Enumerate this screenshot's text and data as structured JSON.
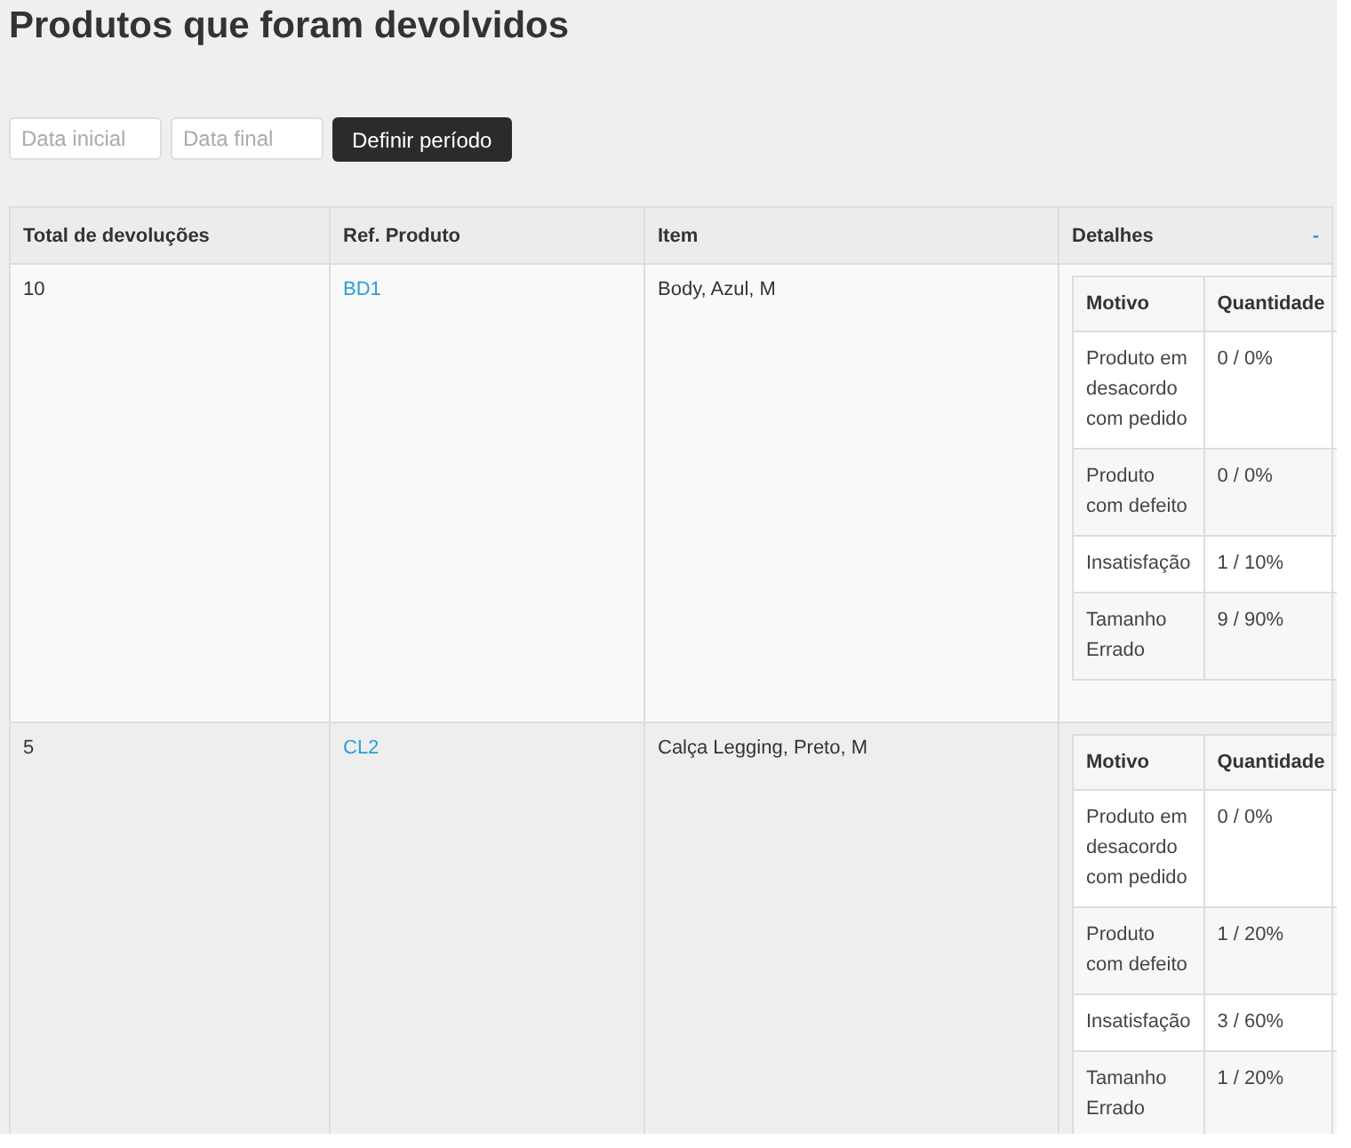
{
  "title": "Produtos que foram devolvidos",
  "filter": {
    "start": {
      "placeholder": "Data inicial"
    },
    "end": {
      "placeholder": "Data final"
    },
    "button": "Definir período"
  },
  "table": {
    "columns": [
      "Total de devoluções",
      "Ref. Produto",
      "Item",
      "Detalhes"
    ],
    "toggle": "-",
    "rows": [
      {
        "total": "10",
        "ref": "BD1",
        "item": "Body, Azul, M",
        "details": {
          "columns": [
            "Motivo",
            "Quantidade"
          ],
          "rows": [
            {
              "reason": "Produto em desacordo com pedido",
              "amount": "0 / 0%"
            },
            {
              "reason": "Produto com defeito",
              "amount": "0 / 0%"
            },
            {
              "reason": "Insatisfação",
              "amount": "1 / 10%"
            },
            {
              "reason": "Tamanho Errado",
              "amount": "9 / 90%"
            }
          ]
        }
      },
      {
        "total": "5",
        "ref": "CL2",
        "item": "Calça Legging, Preto, M",
        "details": {
          "columns": [
            "Motivo",
            "Quantidade"
          ],
          "rows": [
            {
              "reason": "Produto em desacordo com pedido",
              "amount": "0 / 0%"
            },
            {
              "reason": "Produto com defeito",
              "amount": "1 / 20%"
            },
            {
              "reason": "Insatisfação",
              "amount": "3 / 60%"
            },
            {
              "reason": "Tamanho Errado",
              "amount": "1 / 20%"
            }
          ]
        }
      }
    ]
  }
}
